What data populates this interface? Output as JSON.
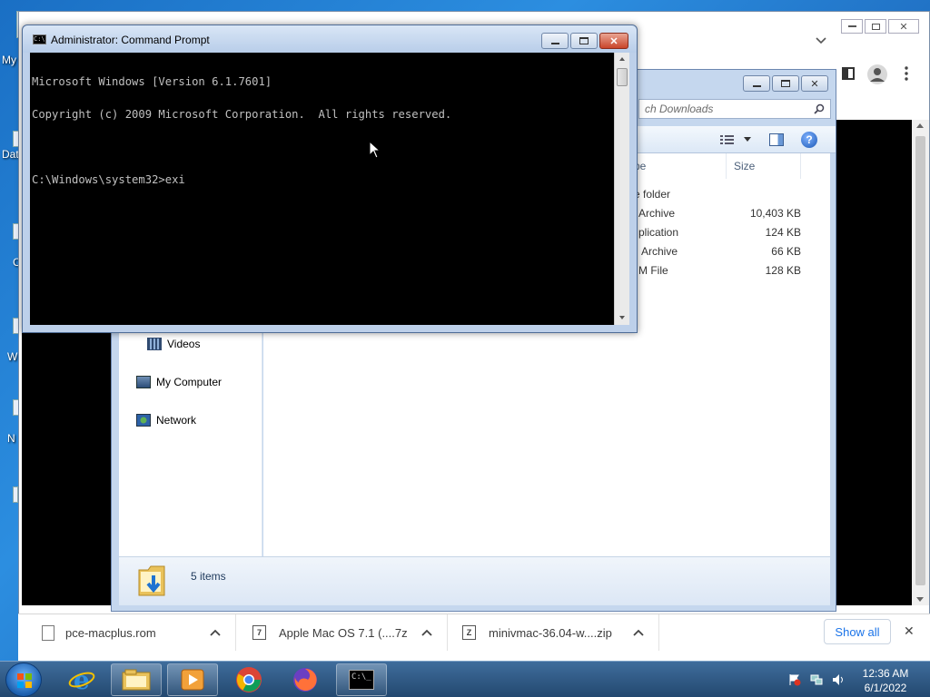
{
  "desktop": {
    "icon_labels": [
      "My",
      "Dat",
      "C",
      "W",
      "N"
    ]
  },
  "explorer": {
    "search_placeholder": "ch Downloads",
    "columns": {
      "type": "pe",
      "size": "Size"
    },
    "rows": [
      {
        "type": "e folder",
        "size": ""
      },
      {
        "type": "Archive",
        "size": "10,403 KB"
      },
      {
        "type": "plication",
        "size": "124 KB"
      },
      {
        "type": "Archive",
        "size": "66 KB"
      },
      {
        "type": "M File",
        "size": "128 KB"
      }
    ],
    "nav": {
      "videos": "Videos",
      "computer": "My Computer",
      "network": "Network"
    },
    "status": "5 items"
  },
  "cmd": {
    "title": "Administrator: Command Prompt",
    "lines": [
      "Microsoft Windows [Version 6.1.7601]",
      "Copyright (c) 2009 Microsoft Corporation.  All rights reserved.",
      "",
      "C:\\Windows\\system32>exi"
    ]
  },
  "downloads": {
    "items": [
      {
        "name": "pce-macplus.rom",
        "icon": "file-icon"
      },
      {
        "name": "Apple Mac OS 7.1 (....7z",
        "icon": "archive-icon"
      },
      {
        "name": "minivmac-36.04-w....zip",
        "icon": "zip-icon"
      }
    ],
    "show_all": "Show all",
    "close_glyph": "✕"
  },
  "taskbar": {
    "apps": [
      "internet-explorer-icon",
      "file-explorer-icon",
      "media-player-icon",
      "chrome-icon",
      "firefox-icon",
      "cmd-icon"
    ],
    "time": "12:36 AM",
    "date": "6/1/2022"
  },
  "colors": {
    "desktop": "#1b64b8",
    "cmd_background": "#000000",
    "cmd_text": "#c0c0c0",
    "link": "#1a73e8"
  }
}
